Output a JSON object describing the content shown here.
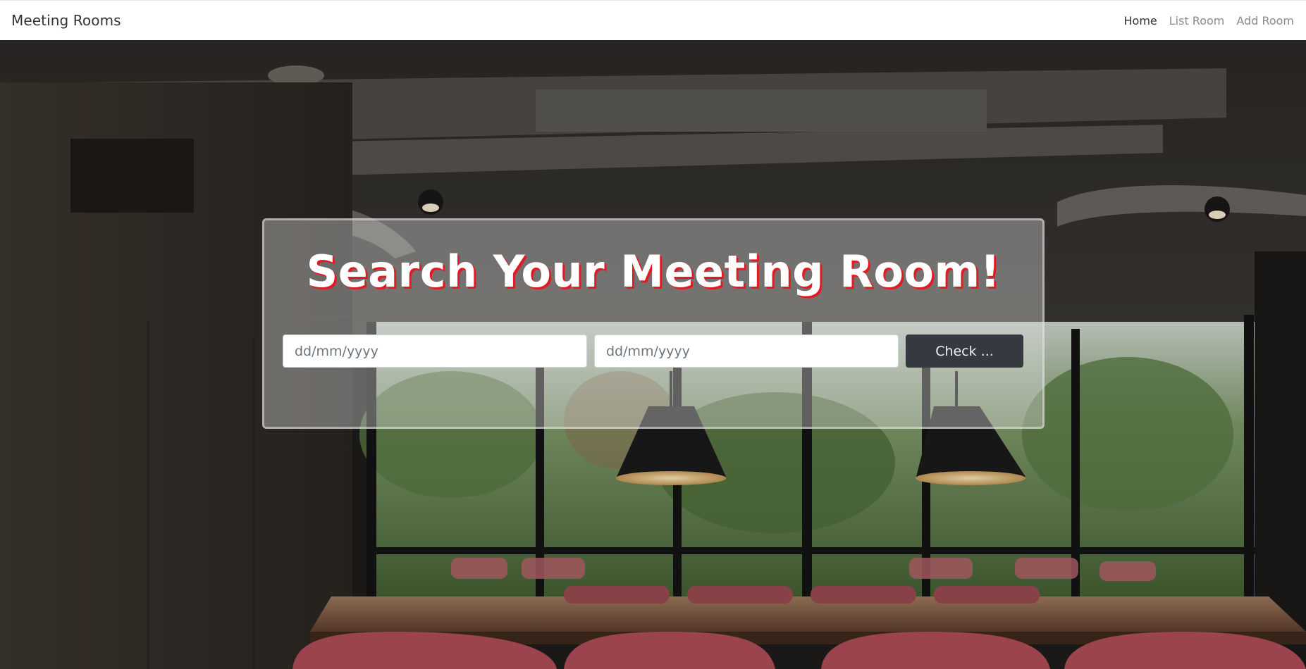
{
  "navbar": {
    "brand": "Meeting Rooms",
    "links": [
      {
        "label": "Home",
        "active": true
      },
      {
        "label": "List Room",
        "active": false
      },
      {
        "label": "Add Room",
        "active": false
      }
    ]
  },
  "search": {
    "title": "Search Your Meeting Room!",
    "start_placeholder": "dd/mm/yyyy",
    "end_placeholder": "dd/mm/yyyy",
    "check_label": "Check ..."
  },
  "colors": {
    "title_shadow": "#e01b24",
    "button_bg": "#343a40",
    "navbar_bg": "#ffffff"
  }
}
